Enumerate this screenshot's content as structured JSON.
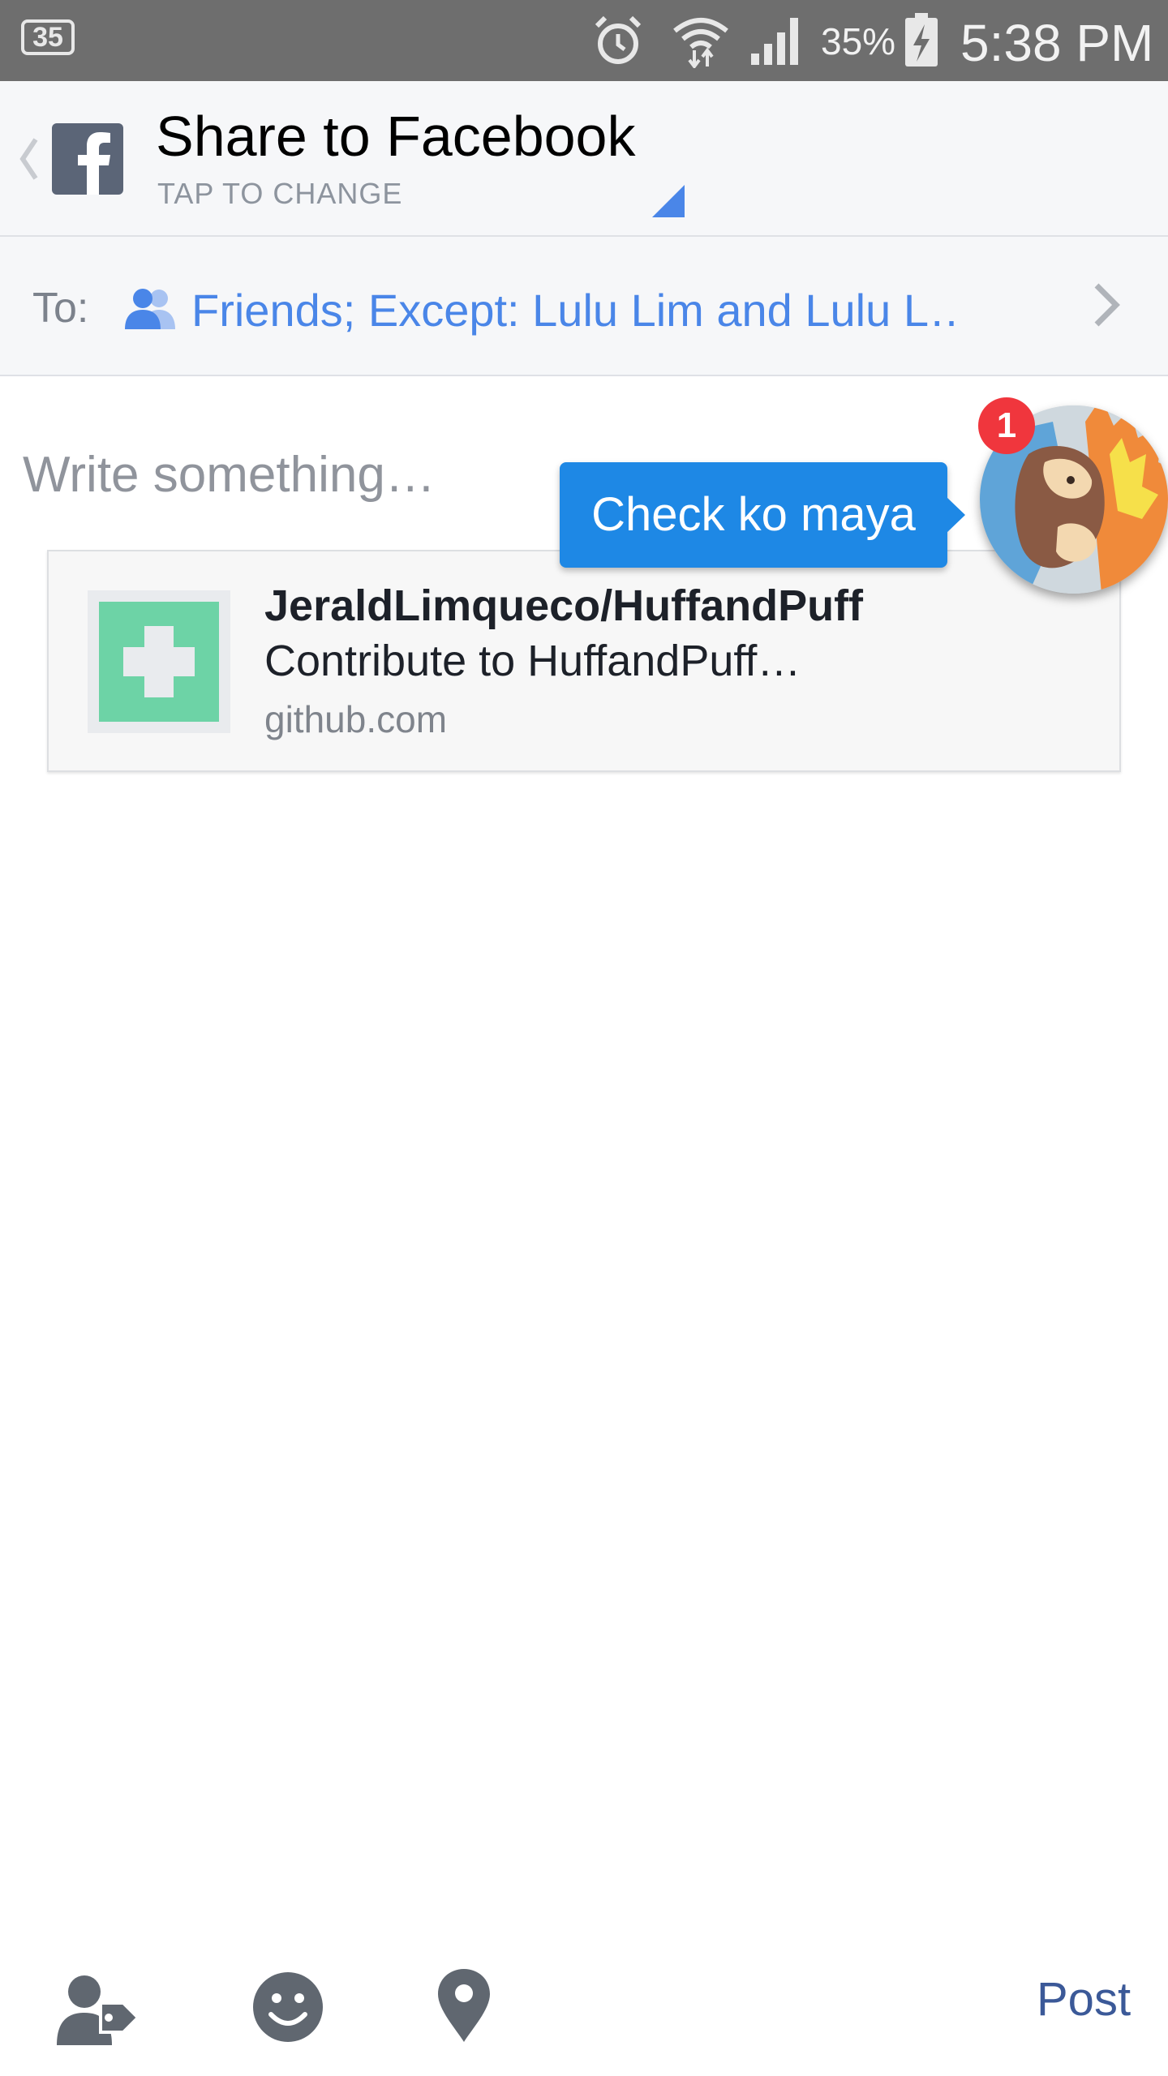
{
  "status_bar": {
    "notification_count": "35",
    "battery_percent": "35%",
    "time": "5:38 PM"
  },
  "header": {
    "title": "Share to Facebook",
    "subtitle": "TAP TO CHANGE"
  },
  "audience": {
    "to_label": "To:",
    "value": "Friends; Except: Lulu Lim and Lulu L…"
  },
  "composer": {
    "placeholder": "Write something…",
    "value": ""
  },
  "link_preview": {
    "title": "JeraldLimqueco/HuffandPuff",
    "description": "Contribute to HuffandPuff…",
    "domain": "github.com"
  },
  "chat_head": {
    "message": "Check ko maya",
    "badge_count": "1"
  },
  "toolbar": {
    "icons": [
      "tag-people-icon",
      "feeling-icon",
      "location-icon"
    ],
    "post_label": "Post"
  },
  "colors": {
    "status_bar": "#6e6e6e",
    "header_bg": "#f6f7f9",
    "audience_text": "#4a86e8",
    "post_blue": "#3b5998",
    "messenger_blue": "#1e88e5",
    "badge_red": "#f0363d",
    "thumb_green": "#6dd3a6"
  }
}
